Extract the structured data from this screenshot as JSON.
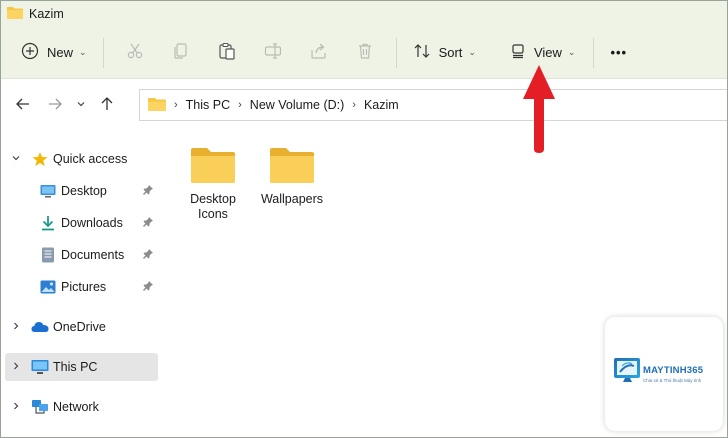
{
  "window": {
    "title": "Kazim"
  },
  "toolbar": {
    "new_label": "New",
    "sort_label": "Sort",
    "view_label": "View",
    "more_label": "•••",
    "icons": [
      "plus-circle-icon",
      "cut-icon",
      "copy-icon",
      "paste-icon",
      "rename-icon",
      "share-icon",
      "delete-icon",
      "sort-icon",
      "view-icon"
    ]
  },
  "address": {
    "crumbs": [
      "This PC",
      "New Volume (D:)",
      "Kazim"
    ]
  },
  "sidebar": {
    "quick_access": "Quick access",
    "items": [
      {
        "label": "Desktop",
        "icon": "desktop-icon",
        "pinned": true
      },
      {
        "label": "Downloads",
        "icon": "download-icon",
        "pinned": true
      },
      {
        "label": "Documents",
        "icon": "document-icon",
        "pinned": true
      },
      {
        "label": "Pictures",
        "icon": "picture-icon",
        "pinned": true
      }
    ],
    "onedrive": "OneDrive",
    "this_pc": "This PC",
    "network": "Network"
  },
  "files": [
    {
      "name_line1": "Desktop",
      "name_line2": "Icons"
    },
    {
      "name_line1": "Wallpapers",
      "name_line2": ""
    }
  ],
  "watermark": {
    "brand": "MAYTINH365",
    "tagline": "Chia sẻ & Thủ thuật Máy tính"
  },
  "colors": {
    "toolbar_bg": "#eef3e6",
    "folder_yellow": "#f6c744",
    "annotation_red": "#e31e24",
    "selected_bg": "#e5e5e5"
  }
}
